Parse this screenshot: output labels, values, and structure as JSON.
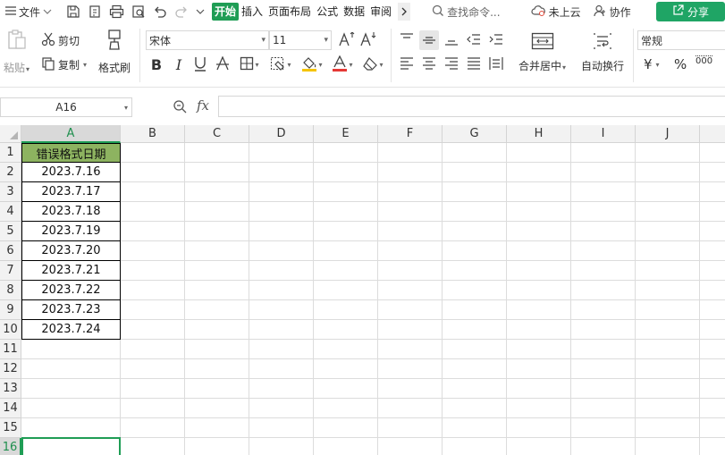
{
  "menu": {
    "file_label": "文件",
    "tabs": [
      "开始",
      "插入",
      "页面布局",
      "公式",
      "数据",
      "审阅"
    ],
    "active_tab": "开始",
    "search_label": "查找命令...",
    "cloud_label": "未上云",
    "collab_label": "协作",
    "share_label": "分享"
  },
  "ribbon": {
    "paste_label": "粘贴",
    "cut_label": "剪切",
    "copy_label": "复制",
    "format_painter_label": "格式刷",
    "font_name": "宋体",
    "font_size": "11",
    "merge_label": "合并居中",
    "wrap_label": "自动换行",
    "number_format": "常规",
    "currency_symbol": "¥",
    "percent_symbol": "%",
    "thousands_symbol": "000"
  },
  "formula_bar": {
    "name_box": "A16",
    "fx": "fx",
    "formula_value": ""
  },
  "grid": {
    "columns": [
      "A",
      "B",
      "C",
      "D",
      "E",
      "F",
      "G",
      "H",
      "I",
      "J"
    ],
    "rows": [
      "1",
      "2",
      "3",
      "4",
      "5",
      "6",
      "7",
      "8",
      "9",
      "10",
      "11",
      "12",
      "13",
      "14",
      "15",
      "16"
    ],
    "active_column": "A",
    "active_row": "16",
    "column_a_values": [
      "错误格式日期",
      "2023.7.16",
      "2023.7.17",
      "2023.7.18",
      "2023.7.19",
      "2023.7.20",
      "2023.7.21",
      "2023.7.22",
      "2023.7.23",
      "2023.7.24"
    ]
  },
  "colors": {
    "accent_green": "#1f9d55",
    "header_fill": "#8db360",
    "share_green": "#1fa565"
  }
}
